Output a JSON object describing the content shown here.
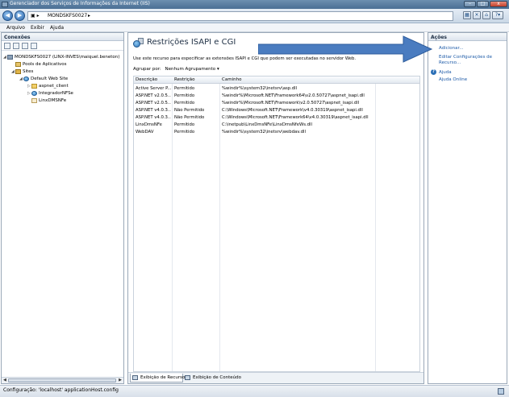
{
  "window": {
    "title": "Gerenciador dos Serviços de Informações da Internet (IIS)"
  },
  "address": {
    "crumbs": [
      "MONDSKFS0027",
      "▸"
    ]
  },
  "menu": {
    "file": "Arquivo",
    "view": "Exibir",
    "help": "Ajuda"
  },
  "connections": {
    "header": "Conexões",
    "tree": {
      "server": "MONDSKFS0027 (LINX-INVES\\maiquel.beneton)",
      "app_pools": "Pools de Aplicativos",
      "sites": "Sites",
      "default_site": "Default Web Site",
      "children": [
        "aspnet_client",
        "IntegradorNFSe",
        "LinxDMSNFe"
      ]
    }
  },
  "main": {
    "title": "Restrições ISAPI e CGI",
    "description": "Use este recurso para especificar as extensões ISAPI e CGI que podem ser executadas no servidor Web.",
    "group_by_label": "Agrupar por:",
    "group_by_value": "Nenhum Agrupamento",
    "columns": [
      "Descrição",
      "Restrição",
      "Caminho"
    ],
    "rows": [
      [
        "Active Server P...",
        "Permitido",
        "%windir%\\system32\\inetsrv\\asp.dll"
      ],
      [
        "ASP.NET v2.0.5...",
        "Permitido",
        "%windir%\\Microsoft.NET\\Framework64\\v2.0.50727\\aspnet_isapi.dll"
      ],
      [
        "ASP.NET v2.0.5...",
        "Permitido",
        "%windir%\\Microsoft.NET\\Framework\\v2.0.50727\\aspnet_isapi.dll"
      ],
      [
        "ASP.NET v4.0.3...",
        "Não Permitido",
        "C:\\Windows\\Microsoft.NET\\Framework\\v4.0.30319\\aspnet_isapi.dll"
      ],
      [
        "ASP.NET v4.0.3...",
        "Não Permitido",
        "C:\\Windows\\Microsoft.NET\\Framework64\\v4.0.30319\\aspnet_isapi.dll"
      ],
      [
        "LinxDmsNFe",
        "Permitido",
        "C:\\inetpub\\LinxDmsNFe\\LinxDmsNfeWs.dll"
      ],
      [
        "WebDAV",
        "Permitido",
        "%windir%\\system32\\inetsrv\\webdav.dll"
      ]
    ],
    "tabs": {
      "features": "Exibição de Recursos",
      "content": "Exibição de Conteúdo"
    }
  },
  "actions": {
    "header": "Ações",
    "add": "Adicionar...",
    "edit_settings_1": "Editar Configurações de",
    "edit_settings_2": "Recurso...",
    "help": "Ajuda",
    "online_help": "Ajuda Online"
  },
  "status": {
    "text": "Configuração: 'localhost' applicationHost.config"
  },
  "colors": {
    "annotation_arrow": "#4a7cc0",
    "link": "#1e5ba8"
  }
}
